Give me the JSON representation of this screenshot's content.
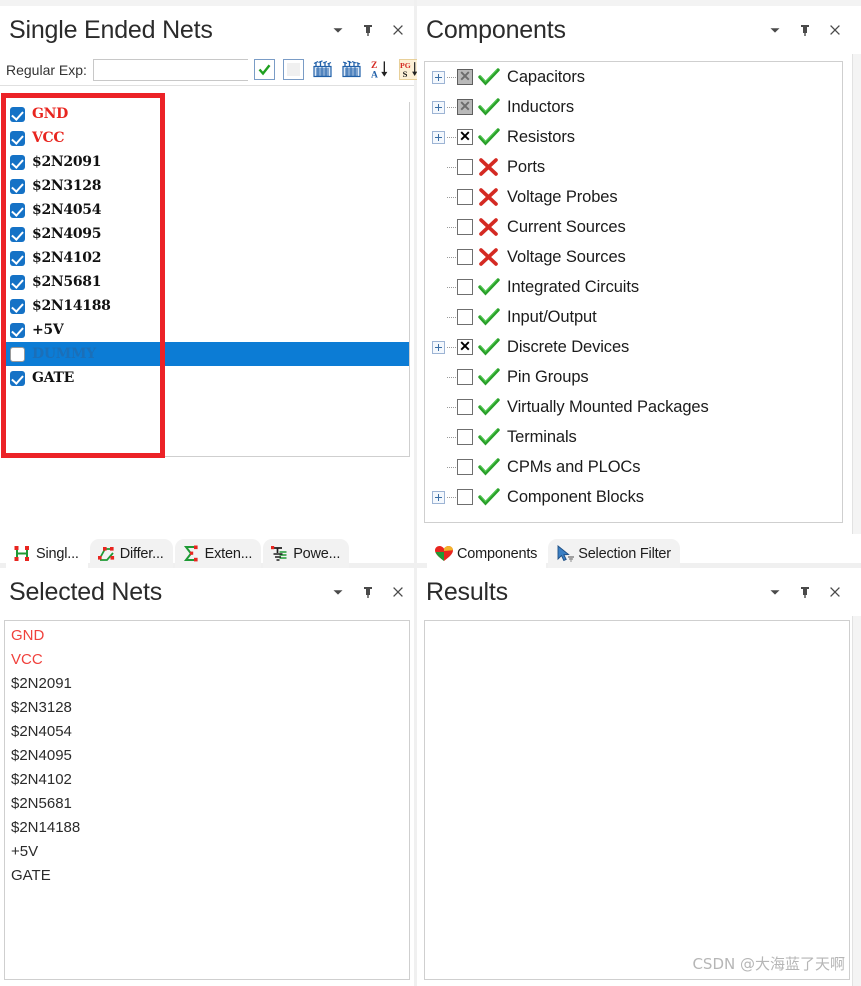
{
  "panels": {
    "single_ended_nets": {
      "title": "Single Ended Nets",
      "filter_label": "Regular Exp:",
      "filter_value": "",
      "filter_placeholder": "",
      "toolbar_icons": [
        "check-all-icon",
        "uncheck-all-icon",
        "select-nets-icon",
        "deselect-nets-icon",
        "sort-za-icon",
        "sort-pgs-icon"
      ],
      "nets": [
        {
          "label": "GND",
          "checked": true,
          "selected": false,
          "power": true
        },
        {
          "label": "VCC",
          "checked": true,
          "selected": false,
          "power": true
        },
        {
          "label": "$2N2091",
          "checked": true,
          "selected": false,
          "power": false
        },
        {
          "label": "$2N3128",
          "checked": true,
          "selected": false,
          "power": false
        },
        {
          "label": "$2N4054",
          "checked": true,
          "selected": false,
          "power": false
        },
        {
          "label": "$2N4095",
          "checked": true,
          "selected": false,
          "power": false
        },
        {
          "label": "$2N4102",
          "checked": true,
          "selected": false,
          "power": false
        },
        {
          "label": "$2N5681",
          "checked": true,
          "selected": false,
          "power": false
        },
        {
          "label": "$2N14188",
          "checked": true,
          "selected": false,
          "power": false
        },
        {
          "label": "+5V",
          "checked": true,
          "selected": false,
          "power": false
        },
        {
          "label": "DUMMY",
          "checked": false,
          "selected": true,
          "power": false
        },
        {
          "label": "GATE",
          "checked": true,
          "selected": false,
          "power": false
        }
      ],
      "tabs": [
        {
          "label": "Singl...",
          "icon": "single-ended-nets-icon",
          "active": true
        },
        {
          "label": "Differ...",
          "icon": "differential-pairs-icon",
          "active": false
        },
        {
          "label": "Exten...",
          "icon": "extended-nets-icon",
          "active": false
        },
        {
          "label": "Powe...",
          "icon": "power-nets-icon",
          "active": false
        }
      ]
    },
    "components": {
      "title": "Components",
      "tree": [
        {
          "label": "Capacitors",
          "expandable": true,
          "check": "x-grey",
          "mark": "green-check"
        },
        {
          "label": "Inductors",
          "expandable": true,
          "check": "x-grey",
          "mark": "green-check"
        },
        {
          "label": "Resistors",
          "expandable": true,
          "check": "x-black",
          "mark": "green-check"
        },
        {
          "label": "Ports",
          "expandable": false,
          "check": "empty",
          "mark": "red-x"
        },
        {
          "label": "Voltage Probes",
          "expandable": false,
          "check": "empty",
          "mark": "red-x"
        },
        {
          "label": "Current Sources",
          "expandable": false,
          "check": "empty",
          "mark": "red-x"
        },
        {
          "label": "Voltage Sources",
          "expandable": false,
          "check": "empty",
          "mark": "red-x"
        },
        {
          "label": "Integrated Circuits",
          "expandable": false,
          "check": "empty",
          "mark": "green-check"
        },
        {
          "label": "Input/Output",
          "expandable": false,
          "check": "empty",
          "mark": "green-check"
        },
        {
          "label": "Discrete Devices",
          "expandable": true,
          "check": "x-black",
          "mark": "green-check"
        },
        {
          "label": "Pin Groups",
          "expandable": false,
          "check": "empty",
          "mark": "green-check"
        },
        {
          "label": "Virtually Mounted Packages",
          "expandable": false,
          "check": "empty",
          "mark": "green-check"
        },
        {
          "label": "Terminals",
          "expandable": false,
          "check": "empty",
          "mark": "green-check"
        },
        {
          "label": "CPMs and PLOCs",
          "expandable": false,
          "check": "empty",
          "mark": "green-check"
        },
        {
          "label": "Component Blocks",
          "expandable": true,
          "check": "empty",
          "mark": "green-check"
        }
      ],
      "tabs": [
        {
          "label": "Components",
          "icon": "components-icon",
          "active": true
        },
        {
          "label": "Selection Filter",
          "icon": "selection-filter-icon",
          "active": false
        }
      ]
    },
    "selected_nets": {
      "title": "Selected Nets",
      "nets": [
        {
          "label": "GND",
          "power": true
        },
        {
          "label": "VCC",
          "power": true
        },
        {
          "label": "$2N2091",
          "power": false
        },
        {
          "label": "$2N3128",
          "power": false
        },
        {
          "label": "$2N4054",
          "power": false
        },
        {
          "label": "$2N4095",
          "power": false
        },
        {
          "label": "$2N4102",
          "power": false
        },
        {
          "label": "$2N5681",
          "power": false
        },
        {
          "label": "$2N14188",
          "power": false
        },
        {
          "label": "+5V",
          "power": false
        },
        {
          "label": "GATE",
          "power": false
        }
      ]
    },
    "results": {
      "title": "Results",
      "content": ""
    }
  },
  "window_controls": {
    "menu": "chevron-down-icon",
    "pin": "pin-icon",
    "close": "close-icon"
  },
  "annotation": {
    "color": "#ec2227",
    "shape": "rectangle-highlight"
  },
  "watermark": "CSDN @大海蓝了天啊",
  "colors": {
    "power_net": "#e8251f",
    "selection": "#0c7cd5",
    "checkbox": "#1572c6",
    "annotation": "#ec2227",
    "green_check": "#2aa02a",
    "red_x": "#d42a23"
  }
}
